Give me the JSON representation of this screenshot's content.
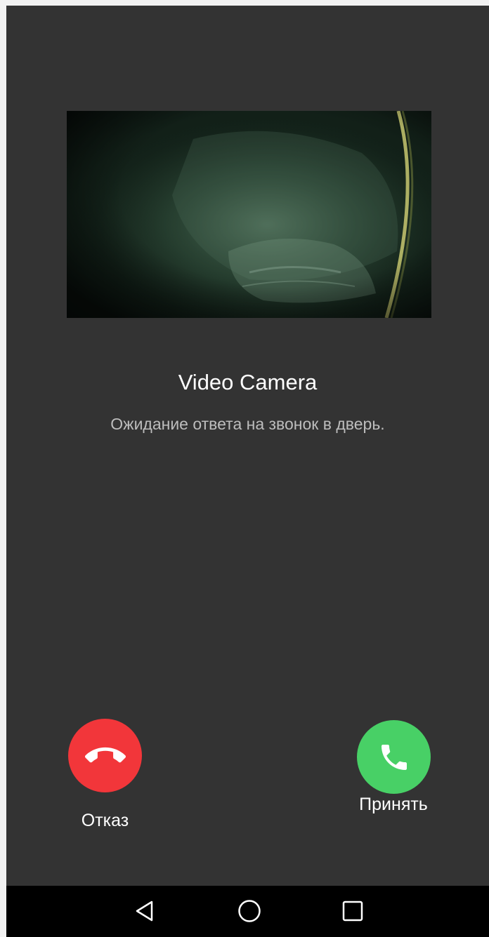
{
  "call": {
    "caller_name": "Video Camera",
    "status_text": "Ожидание ответа на звонок в дверь."
  },
  "actions": {
    "decline_label": "Отказ",
    "accept_label": "Принять"
  },
  "icons": {
    "decline": "hang-up-phone-icon",
    "accept": "phone-icon",
    "nav_back": "back-triangle-icon",
    "nav_home": "home-circle-icon",
    "nav_recent": "recent-apps-square-icon"
  },
  "colors": {
    "background": "#333333",
    "decline": "#f2363a",
    "accept": "#48d066",
    "navbar": "#000000"
  }
}
